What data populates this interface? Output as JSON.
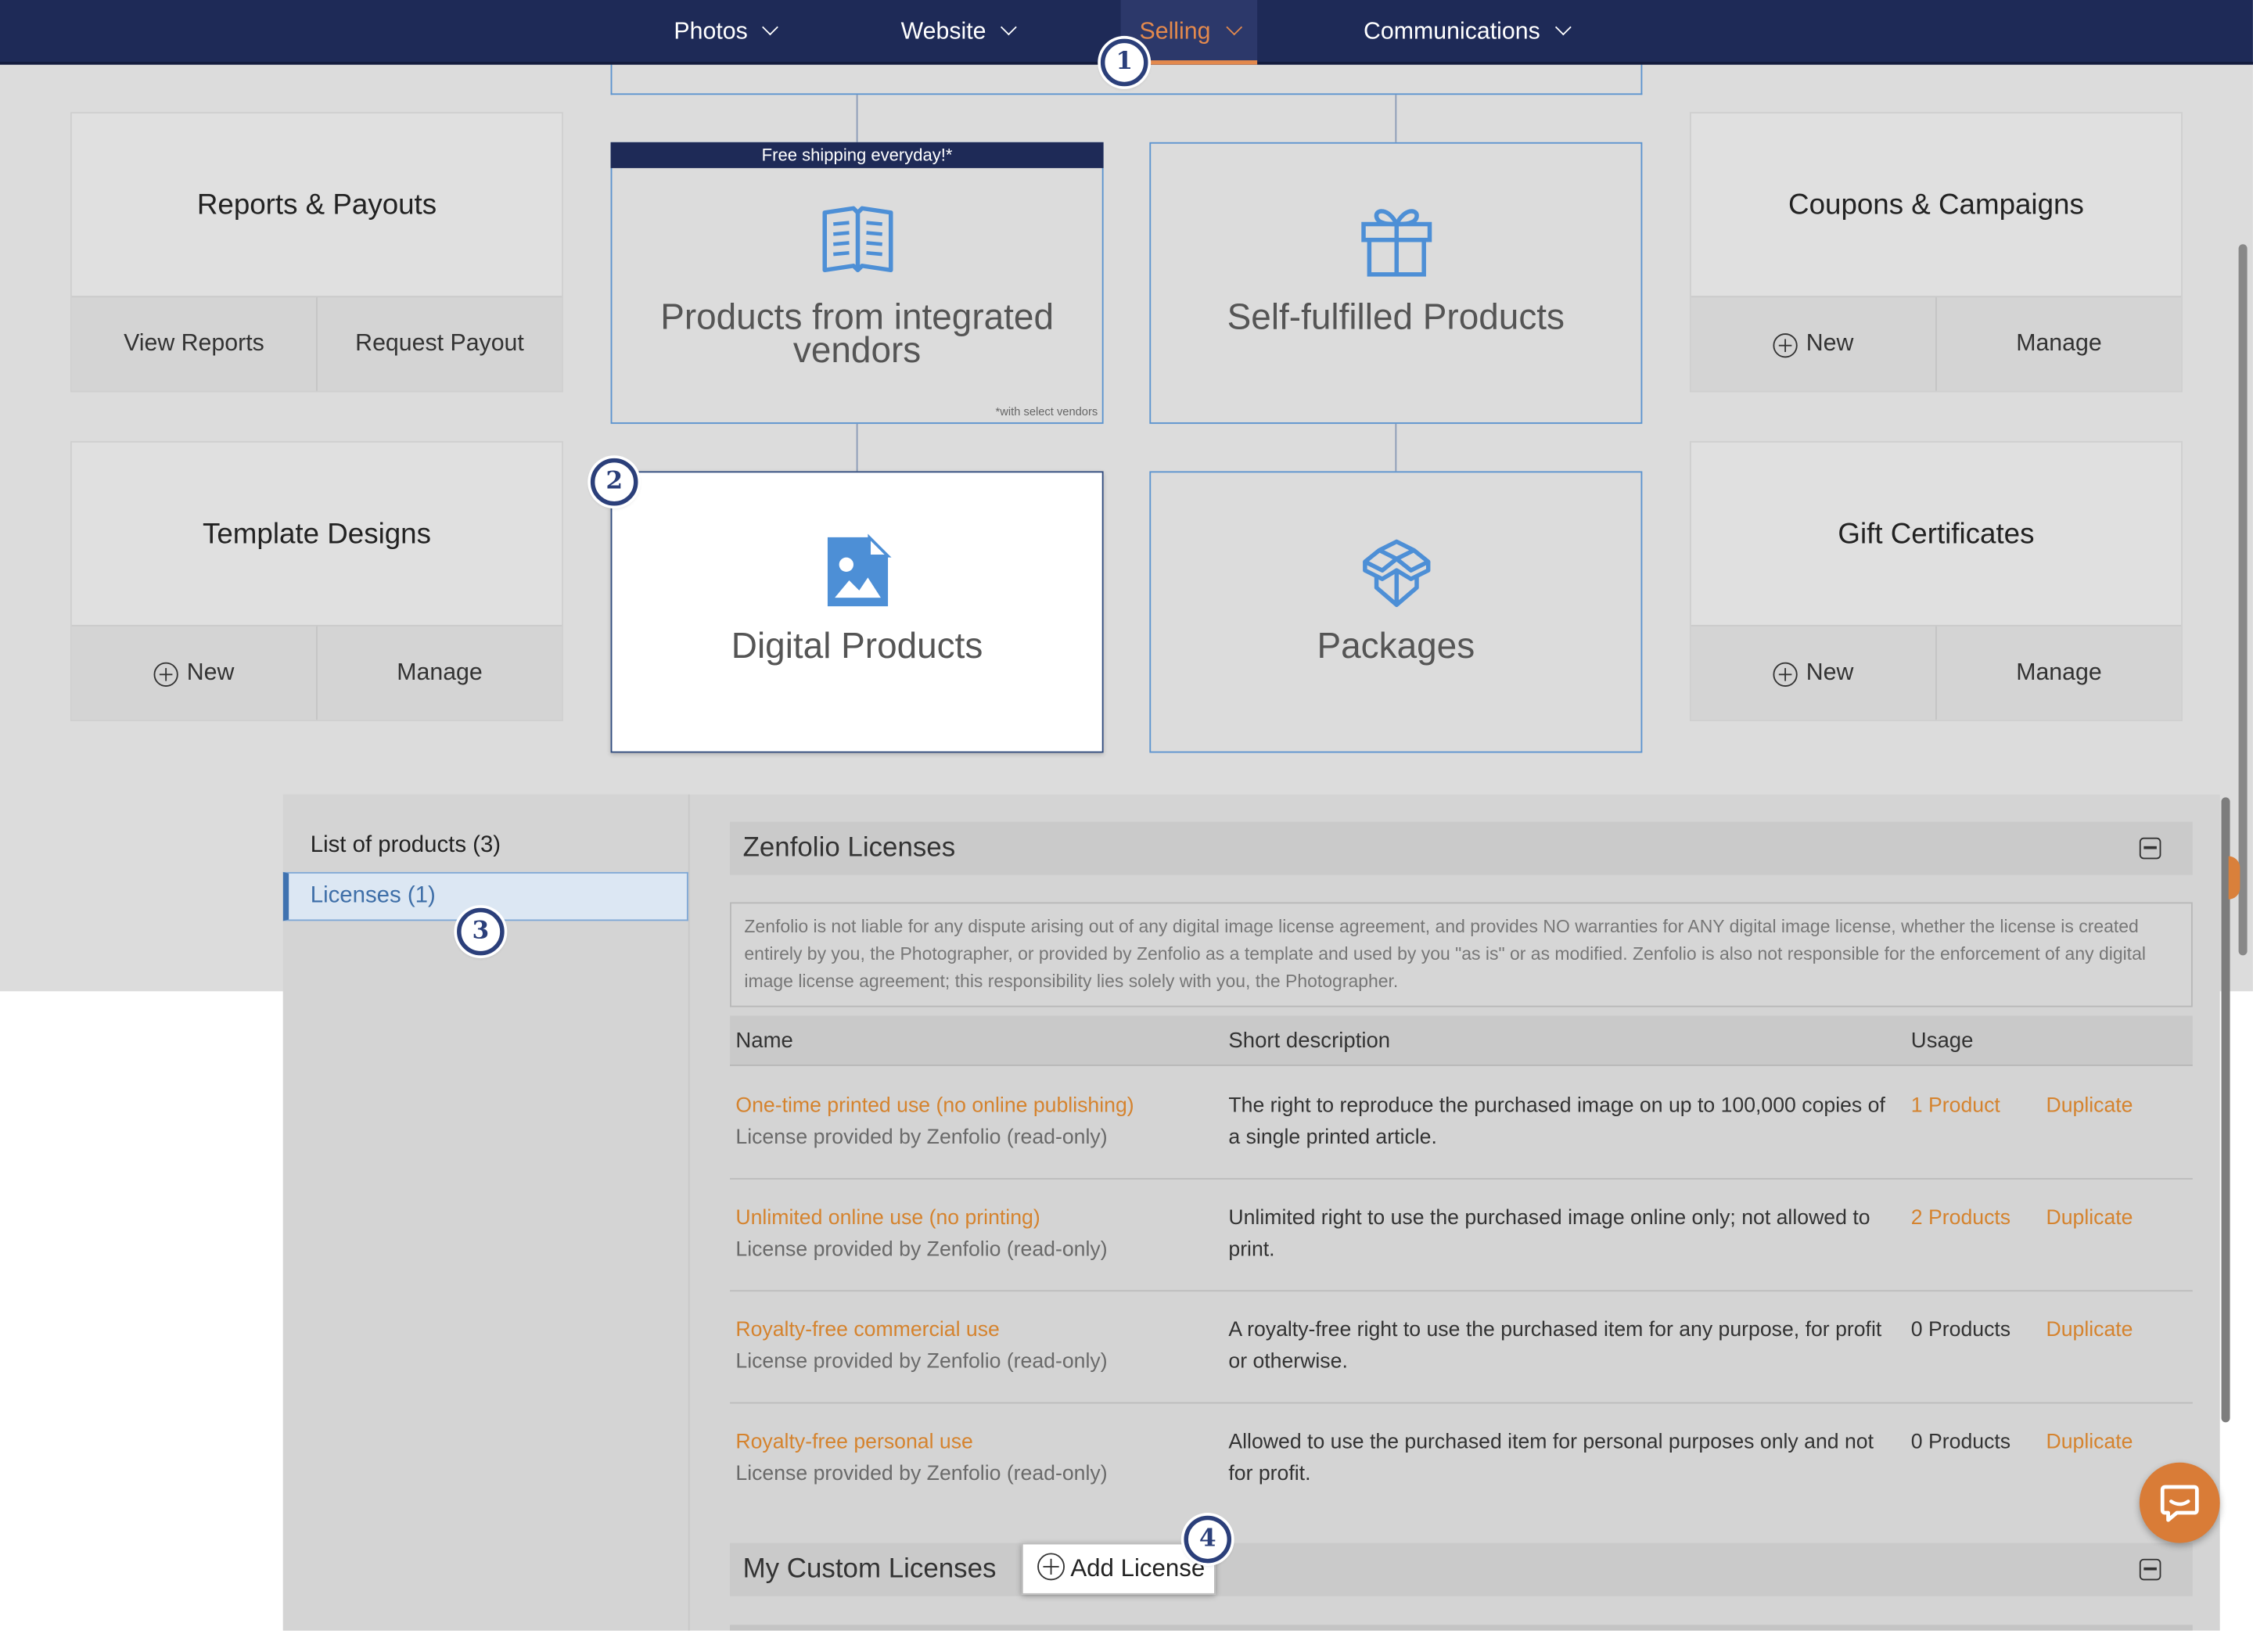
{
  "nav": {
    "items": [
      {
        "label": "Photos"
      },
      {
        "label": "Website"
      },
      {
        "label": "Selling"
      },
      {
        "label": "Communications"
      }
    ]
  },
  "colors": {
    "navy": "#1e2a57",
    "accent_orange": "#d5832e",
    "tile_border_blue": "#5b93cf"
  },
  "callouts": [
    "1",
    "2",
    "3",
    "4"
  ],
  "cards": {
    "reports": {
      "title": "Reports & Payouts",
      "btn1": "View Reports",
      "btn2": "Request Payout"
    },
    "templates": {
      "title": "Template Designs",
      "btn1": "New",
      "btn2": "Manage"
    },
    "coupons": {
      "title": "Coupons & Campaigns",
      "btn1": "New",
      "btn2": "Manage"
    },
    "giftcerts": {
      "title": "Gift Certificates",
      "btn1": "New",
      "btn2": "Manage"
    }
  },
  "tiles": {
    "integrated": {
      "banner": "Free shipping everyday!*",
      "line1": "Products from integrated",
      "line2": "vendors",
      "note": "*with select vendors",
      "icon": "book-icon"
    },
    "selffulfilled": {
      "title": "Self-fulfilled Products",
      "icon": "gift-icon"
    },
    "digital": {
      "title": "Digital Products",
      "icon": "image-file-icon"
    },
    "packages": {
      "title": "Packages",
      "icon": "boxes-icon"
    }
  },
  "sidebar": {
    "heading": "List of products (3)",
    "active_item": "Licenses (1)"
  },
  "licenses": {
    "section_title": "Zenfolio Licenses",
    "disclaimer": "Zenfolio is not liable for any dispute arising out of any digital image license agreement, and provides NO warranties for ANY digital image license, whether the license is created entirely by you, the Photographer, or provided by Zenfolio as a template and used by you \"as is\" or as modified. Zenfolio is also not responsible for the enforcement of any digital image license agreement; this responsibility lies solely with you, the Photographer.",
    "columns": {
      "name": "Name",
      "desc": "Short description",
      "usage": "Usage"
    },
    "rows": [
      {
        "name": "One-time printed use (no online publishing)",
        "sub": "License provided by Zenfolio (read-only)",
        "desc": "The right to reproduce the purchased image on up to 100,000 copies of a single printed article.",
        "usage": "1 Product",
        "action": "Duplicate"
      },
      {
        "name": "Unlimited online use (no printing)",
        "sub": "License provided by Zenfolio (read-only)",
        "desc": "Unlimited right to use the purchased image online only; not allowed to print.",
        "usage": "2 Products",
        "action": "Duplicate"
      },
      {
        "name": "Royalty-free commercial use",
        "sub": "License provided by Zenfolio (read-only)",
        "desc": "A royalty-free right to use the purchased item for any purpose, for profit or otherwise.",
        "usage": "0 Products",
        "action": "Duplicate"
      },
      {
        "name": "Royalty-free personal use",
        "sub": "License provided by Zenfolio (read-only)",
        "desc": "Allowed to use the purchased item for personal purposes only and not for profit.",
        "usage": "0 Products",
        "action": "Duplicate"
      }
    ],
    "custom_title": "My Custom Licenses",
    "add_button": "Add License"
  }
}
